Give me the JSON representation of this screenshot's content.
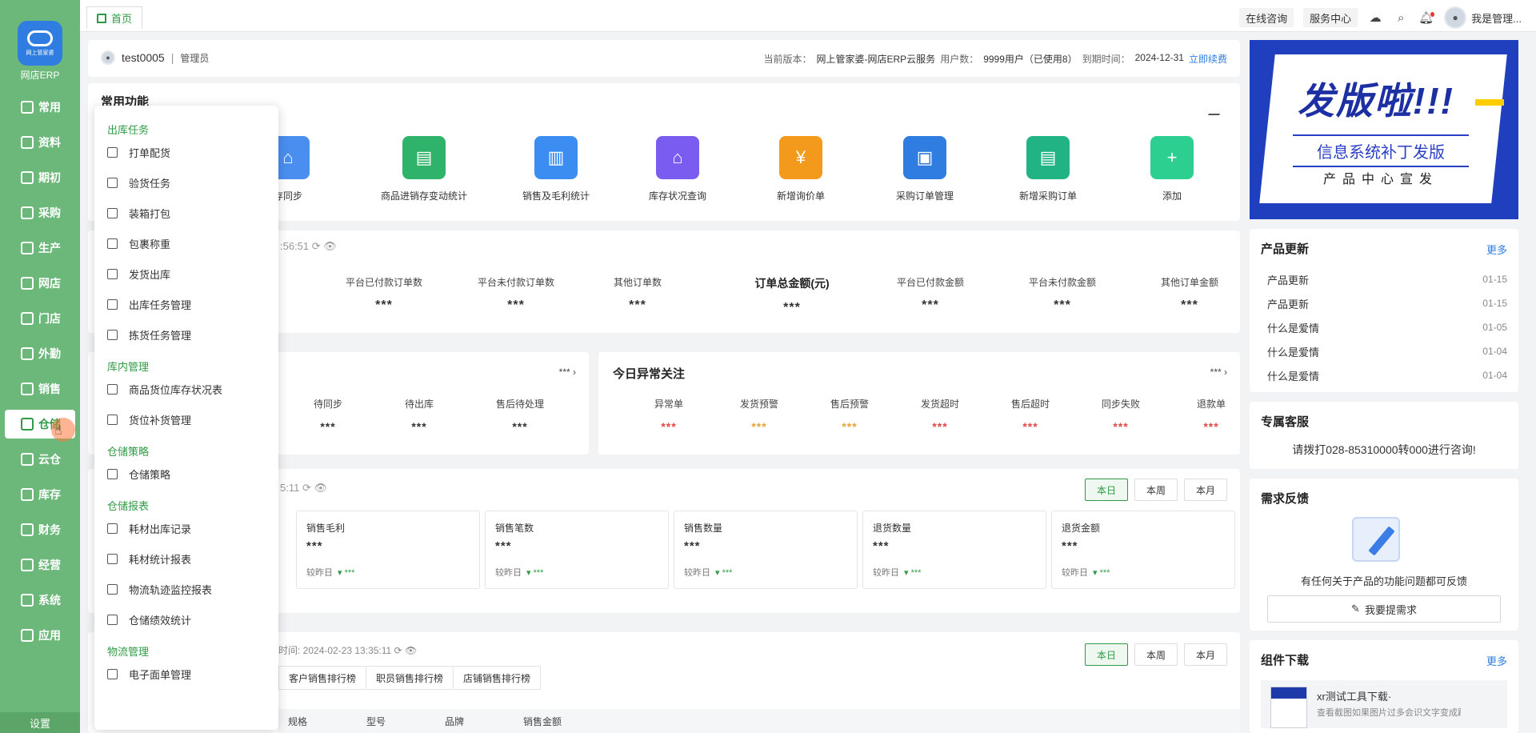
{
  "app": {
    "name": "网店ERP",
    "logo_badge": "网上管家婆",
    "settings": "设置"
  },
  "nav": [
    {
      "label": "常用",
      "icon": "star-icon"
    },
    {
      "label": "资料",
      "icon": "doc-icon"
    },
    {
      "label": "期初",
      "icon": "clock-icon"
    },
    {
      "label": "采购",
      "icon": "cart-icon"
    },
    {
      "label": "生产",
      "icon": "factory-icon"
    },
    {
      "label": "网店",
      "icon": "shop-icon"
    },
    {
      "label": "门店",
      "icon": "store-icon"
    },
    {
      "label": "外勤",
      "icon": "field-icon"
    },
    {
      "label": "销售",
      "icon": "sales-icon"
    },
    {
      "label": "仓储",
      "icon": "warehouse-icon"
    },
    {
      "label": "云仓",
      "icon": "cloud-warehouse-icon"
    },
    {
      "label": "库存",
      "icon": "stock-icon"
    },
    {
      "label": "财务",
      "icon": "finance-icon"
    },
    {
      "label": "经营",
      "icon": "business-icon"
    },
    {
      "label": "系统",
      "icon": "system-icon"
    },
    {
      "label": "应用",
      "icon": "apps-icon"
    }
  ],
  "topbar": {
    "home_tab": "首页",
    "online_consult": "在线咨询",
    "service_center": "服务中心",
    "user": "我是管理..."
  },
  "userbar": {
    "username": "test0005",
    "role": "管理员",
    "version_label": "当前版本：",
    "version": "网上管家婆-网店ERP云服务",
    "users_label": "用户数：",
    "users": "9999用户（已使用8）",
    "expire_label": "到期时间：",
    "expire": "2024-12-31",
    "renew": "立即续费"
  },
  "quick": {
    "title": "常用功能",
    "items": [
      {
        "label": "存同步",
        "color": "#4a8ef0",
        "glyph": "⌂"
      },
      {
        "label": "商品进销存变动统计",
        "color": "#2fb36a",
        "glyph": "▤"
      },
      {
        "label": "销售及毛利统计",
        "color": "#3b8df2",
        "glyph": "▥"
      },
      {
        "label": "库存状况查询",
        "color": "#7b5cf0",
        "glyph": "⌂"
      },
      {
        "label": "新增询价单",
        "color": "#f39a1c",
        "glyph": "¥"
      },
      {
        "label": "采购订单管理",
        "color": "#2f7de0",
        "glyph": "▣"
      },
      {
        "label": "新增采购订单",
        "color": "#22b384",
        "glyph": "▤"
      },
      {
        "label": "添加",
        "color": "#2ccf8f",
        "glyph": "+"
      }
    ]
  },
  "stats": {
    "time": ":56:51",
    "items": [
      {
        "label": "平台已付款订单数",
        "value": "***"
      },
      {
        "label": "平台未付款订单数",
        "value": "***"
      },
      {
        "label": "其他订单数",
        "value": "***"
      },
      {
        "label": "订单总金额(元)",
        "value": "***"
      },
      {
        "label": "平台已付款金额",
        "value": "***"
      },
      {
        "label": "平台未付款金额",
        "value": "***"
      },
      {
        "label": "其他订单金额",
        "value": "***"
      }
    ]
  },
  "todo": {
    "more": "*** ›",
    "items": [
      {
        "label": "待同步",
        "value": "***"
      },
      {
        "label": "待出库",
        "value": "***"
      },
      {
        "label": "售后待处理",
        "value": "***"
      }
    ]
  },
  "anomaly": {
    "title": "今日异常关注",
    "more": "*** ›",
    "items": [
      {
        "label": "异常单",
        "value": "***",
        "color": "#e04848"
      },
      {
        "label": "发货预警",
        "value": "***",
        "color": "#e8a23a"
      },
      {
        "label": "售后预警",
        "value": "***",
        "color": "#e8a23a"
      },
      {
        "label": "发货超时",
        "value": "***",
        "color": "#e04848"
      },
      {
        "label": "售后超时",
        "value": "***",
        "color": "#e04848"
      },
      {
        "label": "同步失败",
        "value": "***",
        "color": "#e04848"
      },
      {
        "label": "退款单",
        "value": "***",
        "color": "#e04848"
      }
    ]
  },
  "sales": {
    "time": "5:11",
    "periods": [
      "本日",
      "本周",
      "本月"
    ],
    "cards": [
      {
        "label": "销售毛利",
        "value": "***",
        "cmp": "较昨日",
        "delta": "▾ ***"
      },
      {
        "label": "销售笔数",
        "value": "***",
        "cmp": "较昨日",
        "delta": "▾ ***"
      },
      {
        "label": "销售数量",
        "value": "***",
        "cmp": "较昨日",
        "delta": "▾ ***"
      },
      {
        "label": "退货数量",
        "value": "***",
        "cmp": "较昨日",
        "delta": "▾ ***"
      },
      {
        "label": "退货金额",
        "value": "***",
        "cmp": "较昨日",
        "delta": "▾ ***"
      }
    ]
  },
  "rank": {
    "info": "时间: 2024-02-23 13:35:11",
    "periods": [
      "本日",
      "本周",
      "本月"
    ],
    "tabs": [
      "客户销售排行榜",
      "职员销售排行榜",
      "店铺销售排行榜"
    ],
    "columns": [
      "规格",
      "型号",
      "品牌",
      "销售金额"
    ]
  },
  "banner": {
    "headline": "发版啦!!!",
    "subtitle": "信息系统补丁发版",
    "footer": "产品中心宣发"
  },
  "product_updates": {
    "title": "产品更新",
    "more": "更多",
    "items": [
      {
        "title": "产品更新",
        "date": "01-15"
      },
      {
        "title": "产品更新",
        "date": "01-15"
      },
      {
        "title": "什么是爱情",
        "date": "01-05"
      },
      {
        "title": "什么是爱情",
        "date": "01-04"
      },
      {
        "title": "什么是爱情",
        "date": "01-04"
      }
    ]
  },
  "service": {
    "title": "专属客服",
    "text": "请拨打028-85310000转000进行咨询!"
  },
  "feedback": {
    "title": "需求反馈",
    "text": "有任何关于产品的功能问题都可反馈",
    "button": "我要提需求"
  },
  "downloads": {
    "title": "组件下载",
    "more": "更多",
    "name": "xr测试工具下载·",
    "desc": "查看截图如果图片过多会识文字变成践行..."
  },
  "dropdown": {
    "groups": [
      {
        "label": "出库任务",
        "items": [
          "打单配货",
          "验货任务",
          "装箱打包",
          "包裹称重",
          "发货出库",
          "出库任务管理",
          "拣货任务管理"
        ]
      },
      {
        "label": "库内管理",
        "items": [
          "商品货位库存状况表",
          "货位补货管理"
        ]
      },
      {
        "label": "仓储策略",
        "items": [
          "仓储策略"
        ]
      },
      {
        "label": "仓储报表",
        "items": [
          "耗材出库记录",
          "耗材统计报表",
          "物流轨迹监控报表",
          "仓储绩效统计"
        ]
      },
      {
        "label": "物流管理",
        "items": [
          "电子面单管理"
        ]
      }
    ]
  }
}
